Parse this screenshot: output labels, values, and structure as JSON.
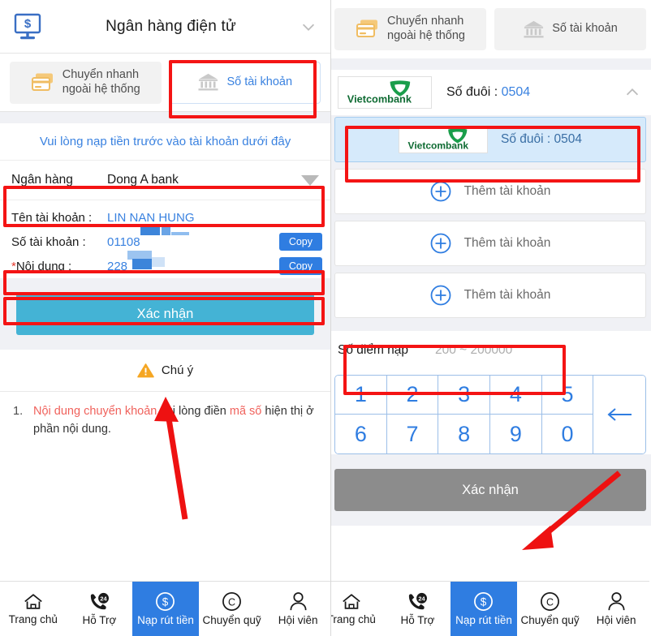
{
  "left": {
    "header": {
      "icon": "monitor-dollar-icon",
      "title": "Ngân hàng điện tử",
      "collapse_icon": "chevron-down-icon"
    },
    "tabs": [
      {
        "label": "Chuyển nhanh\nngoài hệ thống",
        "icon": "card-icon",
        "active": false
      },
      {
        "label": "Số tài khoản",
        "icon": "bank-icon",
        "active": true
      }
    ],
    "notice": "Vui lòng nạp tiền trước vào tài khoản dưới đây",
    "bank_select": {
      "label": "Ngân hàng",
      "value": "Dong A bank",
      "caret_icon": "caret-down-icon"
    },
    "info": {
      "account_name_key": "Tên tài khoản :",
      "account_name_value": "LIN NAN HUNG",
      "account_number_key": "Số tài khoản :",
      "account_number_value": "01108",
      "content_star": "*",
      "content_key": "Nội dung :",
      "content_value": "228",
      "copy_label": "Copy"
    },
    "confirm_label": "Xác nhận",
    "attention": {
      "icon": "warning-icon",
      "label": "Chú ý"
    },
    "notes": [
      {
        "num": "1.",
        "part1": "Nội dung chuyển khoản",
        "part2": " vui lòng điền ",
        "part3": "mã số",
        "part4": " hiện thị ở phần nội dung."
      }
    ]
  },
  "right": {
    "tabs": [
      {
        "label": "Chuyển nhanh\nngoài hệ thống",
        "icon": "card-icon",
        "active": false
      },
      {
        "label": "Số tài khoản",
        "icon": "bank-icon",
        "active": false
      }
    ],
    "bank_header": {
      "logo": "vietcombank-logo",
      "logo_text": "Vietcombank",
      "suffix_label": "Số đuôi :",
      "suffix_value": "0504",
      "collapse_icon": "chevron-up-icon"
    },
    "accounts": [
      {
        "type": "bank",
        "logo_text": "Vietcombank",
        "suffix_label": "Số đuôi :",
        "suffix_value": "0504",
        "selected": true
      },
      {
        "type": "add",
        "label": "Thêm tài khoản",
        "icon": "plus-circle-icon"
      },
      {
        "type": "add",
        "label": "Thêm tài khoản",
        "icon": "plus-circle-icon"
      },
      {
        "type": "add",
        "label": "Thêm tài khoản",
        "icon": "plus-circle-icon"
      }
    ],
    "amount": {
      "label": "Số điểm nạp",
      "placeholder": "200 ~ 200000",
      "value": ""
    },
    "keypad": {
      "keys": [
        "1",
        "2",
        "3",
        "4",
        "5",
        "6",
        "7",
        "8",
        "9",
        "0"
      ],
      "backspace_icon": "backspace-arrow-icon"
    },
    "confirm_label": "Xác nhận"
  },
  "bottom_nav": [
    {
      "label": "Trang chủ",
      "icon": "home-icon",
      "active": false
    },
    {
      "label": "Hỗ Trợ",
      "icon": "support-24-icon",
      "active": false
    },
    {
      "label": "Nạp rút tiền",
      "icon": "dollar-circle-icon",
      "active": true
    },
    {
      "label": "Chuyển quỹ",
      "icon": "copyright-c-icon",
      "active": false
    },
    {
      "label": "Hội viên",
      "icon": "user-icon",
      "active": false
    }
  ],
  "colors": {
    "accent_blue": "#2f7de1",
    "link_blue": "#3a82e0",
    "confirm_blue": "#44b3d5",
    "confirm_gray": "#8c8c8c",
    "annotation_red": "#f41414",
    "warning_orange": "#f5a623",
    "vietcombank_green": "#0f8a42"
  }
}
